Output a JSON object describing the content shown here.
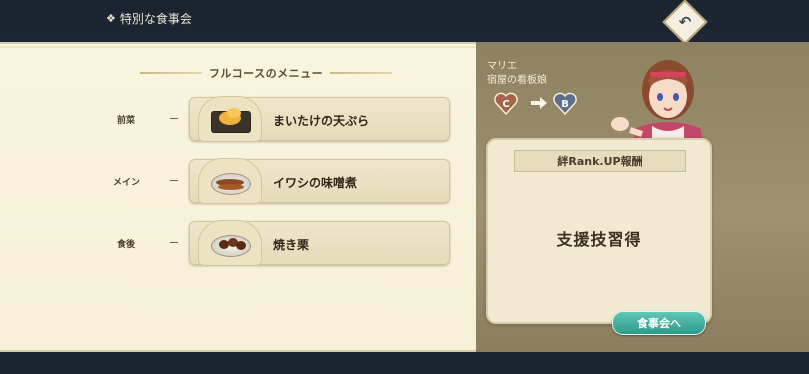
{
  "header": {
    "title": "特別な食事会",
    "back_icon": "return-arrow-icon"
  },
  "menu": {
    "title": "フルコースのメニュー",
    "courses": [
      {
        "label": "前菜",
        "dish": "まいたけの天ぷら",
        "icon": "tempura-dish-icon"
      },
      {
        "label": "メイン",
        "dish": "イワシの味噌煮",
        "icon": "sardine-dish-icon"
      },
      {
        "label": "食後",
        "dish": "焼き栗",
        "icon": "roasted-chestnut-icon"
      }
    ]
  },
  "character": {
    "name": "マリエ",
    "role": "宿屋の看板娘",
    "rank_from": "C",
    "rank_to": "B"
  },
  "reward": {
    "title": "絆Rank.UP報酬",
    "text": "支援技習得"
  },
  "actions": {
    "go_label": "食事会へ"
  },
  "colors": {
    "panel": "#f6f0d8",
    "accent_teal": "#2e9a89",
    "right_panel": "#9a8c6a"
  }
}
